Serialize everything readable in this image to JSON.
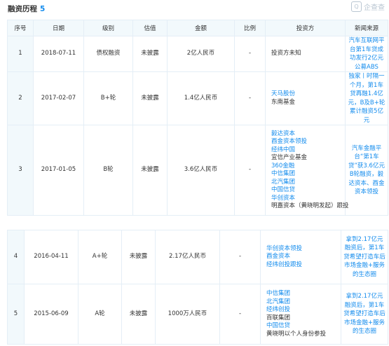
{
  "header": {
    "title": "融资历程",
    "count": "5",
    "watermark": "企查查"
  },
  "columns": [
    "序号",
    "日期",
    "级别",
    "估值",
    "金额",
    "比例",
    "投资方",
    "新闻来源"
  ],
  "rows": [
    {
      "seq": "1",
      "date": "2018-07-11",
      "level": "债权融资",
      "valuation": "未披露",
      "amount": "2亿人民币",
      "ratio": "-",
      "investors": [
        {
          "name": "投资方未知",
          "link": false
        }
      ],
      "news": "汽车互联网平台第1车贷成功发行2亿元公募ABS"
    },
    {
      "seq": "2",
      "date": "2017-02-07",
      "level": "B+轮",
      "valuation": "未披露",
      "amount": "1.4亿人民币",
      "ratio": "-",
      "investors": [
        {
          "name": "天马股份",
          "link": true
        },
        {
          "name": "东南基金",
          "link": false
        }
      ],
      "news": "独家丨时隔一个月，第1车贷再融1.4亿元，B及B+轮累计融资5亿元"
    },
    {
      "seq": "3",
      "date": "2017-01-05",
      "level": "B轮",
      "valuation": "未披露",
      "amount": "3.6亿人民币",
      "ratio": "-",
      "investors": [
        {
          "name": "毅达资本",
          "link": true
        },
        {
          "name": "酉金资本领投",
          "link": true
        },
        {
          "name": "经纬中国",
          "link": true
        },
        {
          "name": "宜信产业基金",
          "link": false
        },
        {
          "name": "360金融",
          "link": true
        },
        {
          "name": "中信集团",
          "link": true
        },
        {
          "name": "北汽集团",
          "link": true
        },
        {
          "name": "中国信贷",
          "link": true
        },
        {
          "name": "华创资本",
          "link": true
        },
        {
          "name": "明嘉资本（黄晓明发起）跟投",
          "link": false
        }
      ],
      "news": "汽车金融平台“第1车贷”获3.6亿元B轮融资，毅达资本、酉金资本领投"
    },
    {
      "seq": "4",
      "date": "2016-04-11",
      "level": "A+轮",
      "valuation": "未披露",
      "amount": "2.17亿人民币",
      "ratio": "-",
      "investors": [
        {
          "name": "华创资本领投",
          "link": true
        },
        {
          "name": "酉金资本",
          "link": true
        },
        {
          "name": "经纬创投跟投",
          "link": true
        }
      ],
      "news": "拿到2.17亿元融资后，第1车贷希望打造车后市场金融+服务的生态圈"
    },
    {
      "seq": "5",
      "date": "2015-06-09",
      "level": "A轮",
      "valuation": "未披露",
      "amount": "1000万人民币",
      "ratio": "-",
      "investors": [
        {
          "name": "中信集团",
          "link": true
        },
        {
          "name": "北汽集团",
          "link": true
        },
        {
          "name": "经纬创投",
          "link": true
        },
        {
          "name": "百联集团",
          "link": false
        },
        {
          "name": "中国信贷",
          "link": true
        },
        {
          "name": "黄晓明以个人身份参投",
          "link": false
        }
      ],
      "news": "拿到2.17亿元融资后，第1车贷希望打造车后市场金融+服务的生态圈"
    }
  ],
  "colors": {
    "accent": "#128bed",
    "header_bg": "#f2f9fc",
    "border": "#e4eef6",
    "text": "#333333"
  }
}
